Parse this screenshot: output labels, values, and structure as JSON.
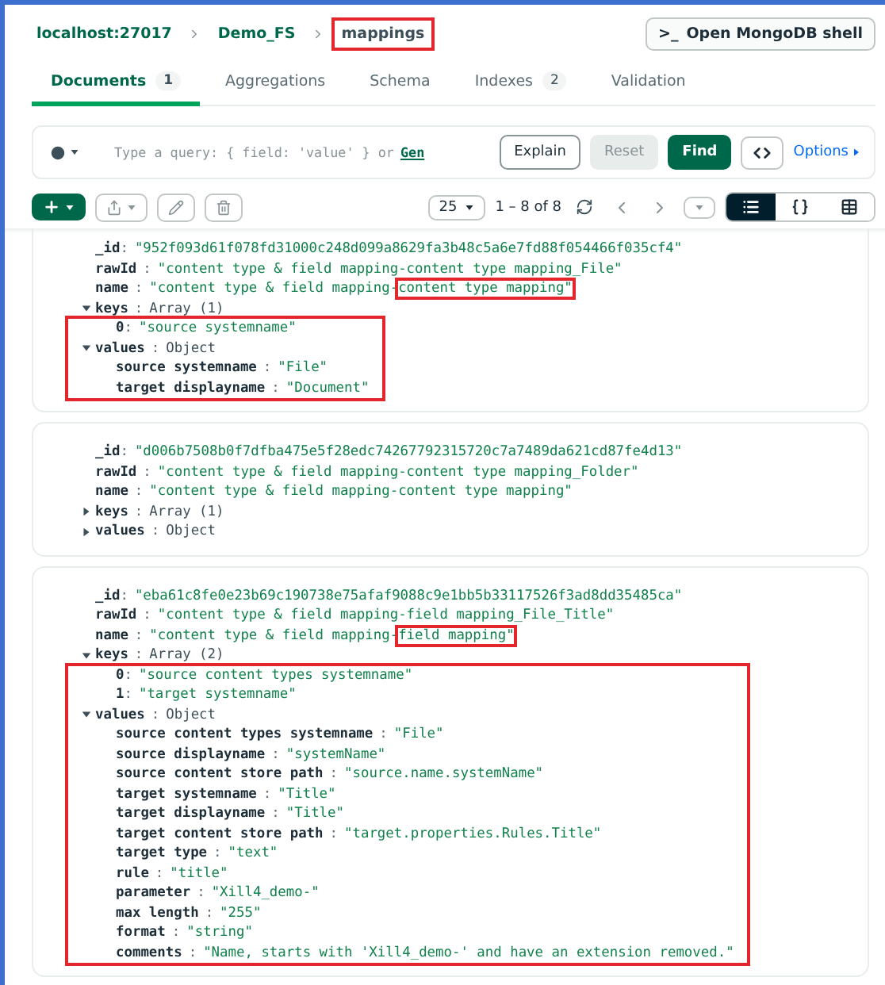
{
  "breadcrumb": [
    {
      "label": "localhost:27017",
      "highlighted": false
    },
    {
      "label": "Demo_FS",
      "highlighted": false
    },
    {
      "label": "mappings",
      "highlighted": true
    }
  ],
  "shell_button": {
    "prompt": ">_",
    "label": "Open MongoDB shell"
  },
  "tabs": [
    {
      "label": "Documents",
      "count": "1",
      "selected": true
    },
    {
      "label": "Aggregations",
      "selected": false
    },
    {
      "label": "Schema",
      "selected": false
    },
    {
      "label": "Indexes",
      "count": "2",
      "selected": false
    },
    {
      "label": "Validation",
      "selected": false
    }
  ],
  "query": {
    "placeholder": "Type a query: { field: 'value' } or",
    "link": "Gen",
    "buttons": [
      {
        "label": "Explain",
        "kind": "secondary",
        "disabled": false
      },
      {
        "label": "Reset",
        "kind": "secondary",
        "disabled": true
      },
      {
        "label": "Find",
        "kind": "primary",
        "disabled": false
      }
    ],
    "options": "Options"
  },
  "toolbar": {
    "page_size": "25",
    "range": "1 – 8 of 8",
    "views": [
      {
        "kind": "list",
        "selected": true
      },
      {
        "kind": "json",
        "selected": false
      },
      {
        "kind": "table",
        "selected": false
      }
    ]
  },
  "documents": [
    {
      "sections": [
        {
          "highlighted": false,
          "rows": [
            {
              "kind": "field",
              "key": "_id",
              "colon": ":",
              "tight": true,
              "value": "\"952f093d61f078fd31000c248d099a8629fa3b48c5a6e7fd88f054466f035cf4\""
            },
            {
              "kind": "field",
              "key": "rawId",
              "colon": ":",
              "tight": false,
              "value": "\"content type & field mapping-content type mapping_File\""
            },
            {
              "kind": "field",
              "key": "name",
              "colon": ":",
              "tight": false,
              "value": "\"content type & field mapping-",
              "mark": "content type mapping\""
            },
            {
              "kind": "toggle",
              "key": "keys",
              "colon": ":",
              "tight": false,
              "value": "Array (1)",
              "expanded": true
            }
          ]
        },
        {
          "highlighted": true,
          "rows": [
            {
              "kind": "nested",
              "key": "0",
              "colon": ":",
              "tight": true,
              "value": "\"source systemname\""
            },
            {
              "kind": "toggle",
              "key": "values",
              "colon": ":",
              "tight": false,
              "value": "Object",
              "expanded": true
            },
            {
              "kind": "nested",
              "key": "source systemname",
              "colon": ":",
              "tight": false,
              "value": "\"File\""
            },
            {
              "kind": "nested",
              "key": "target displayname",
              "colon": ":",
              "tight": false,
              "value": "\"Document\""
            }
          ]
        }
      ]
    },
    {
      "sections": [
        {
          "highlighted": false,
          "rows": [
            {
              "kind": "field",
              "key": "_id",
              "colon": ":",
              "tight": true,
              "value": "\"d006b7508b0f7dfba475e5f28edc74267792315720c7a7489da621cd87fe4d13\""
            },
            {
              "kind": "field",
              "key": "rawId",
              "colon": ":",
              "tight": false,
              "value": "\"content type & field mapping-content type mapping_Folder\""
            },
            {
              "kind": "field",
              "key": "name",
              "colon": ":",
              "tight": false,
              "value": "\"content type & field mapping-content type mapping\""
            },
            {
              "kind": "toggle",
              "key": "keys",
              "colon": ":",
              "tight": false,
              "value": "Array (1)",
              "expanded": false
            },
            {
              "kind": "toggle",
              "key": "values",
              "colon": ":",
              "tight": false,
              "value": "Object",
              "expanded": false
            }
          ]
        }
      ]
    },
    {
      "sections": [
        {
          "highlighted": false,
          "rows": [
            {
              "kind": "field",
              "key": "_id",
              "colon": ":",
              "tight": true,
              "value": "\"eba61c8fe0e23b69c190738e75afaf9088c9e1bb5b33117526f3ad8dd35485ca\""
            },
            {
              "kind": "field",
              "key": "rawId",
              "colon": ":",
              "tight": false,
              "value": "\"content type & field mapping-field mapping_File_Title\""
            },
            {
              "kind": "field",
              "key": "name",
              "colon": ":",
              "tight": false,
              "value": "\"content type & field mapping-",
              "mark": "field mapping\""
            },
            {
              "kind": "toggle",
              "key": "keys",
              "colon": ":",
              "tight": false,
              "value": "Array (2)",
              "expanded": true
            }
          ]
        },
        {
          "highlighted": true,
          "rows": [
            {
              "kind": "nested",
              "key": "0",
              "colon": ":",
              "tight": true,
              "value": "\"source content types systemname\""
            },
            {
              "kind": "nested",
              "key": "1",
              "colon": ":",
              "tight": true,
              "value": "\"target systemname\""
            },
            {
              "kind": "toggle",
              "key": "values",
              "colon": ":",
              "tight": false,
              "value": "Object",
              "expanded": true
            },
            {
              "kind": "nested",
              "key": "source content types systemname",
              "colon": ":",
              "tight": false,
              "value": "\"File\""
            },
            {
              "kind": "nested",
              "key": "source displayname",
              "colon": ":",
              "tight": false,
              "value": "\"systemName\""
            },
            {
              "kind": "nested",
              "key": "source content store path",
              "colon": ":",
              "tight": false,
              "value": "\"source.name.systemName\""
            },
            {
              "kind": "nested",
              "key": "target systemname",
              "colon": ":",
              "tight": false,
              "value": "\"Title\""
            },
            {
              "kind": "nested",
              "key": "target displayname",
              "colon": ":",
              "tight": false,
              "value": "\"Title\""
            },
            {
              "kind": "nested",
              "key": "target content store path",
              "colon": ":",
              "tight": false,
              "value": "\"target.properties.Rules.Title\""
            },
            {
              "kind": "nested",
              "key": "target type",
              "colon": ":",
              "tight": false,
              "value": "\"text\""
            },
            {
              "kind": "nested",
              "key": "rule",
              "colon": ":",
              "tight": false,
              "value": "\"title\""
            },
            {
              "kind": "nested",
              "key": "parameter",
              "colon": ":",
              "tight": false,
              "value": "\"Xill4_demo-\""
            },
            {
              "kind": "nested",
              "key": "max length",
              "colon": ":",
              "tight": false,
              "value": "\"255\""
            },
            {
              "kind": "nested",
              "key": "format",
              "colon": ":",
              "tight": false,
              "value": "\"string\""
            },
            {
              "kind": "nested",
              "key": "comments",
              "colon": ":",
              "tight": false,
              "value": "\"Name, starts with 'Xill4_demo-' and have an extension removed.\""
            }
          ]
        }
      ]
    }
  ]
}
